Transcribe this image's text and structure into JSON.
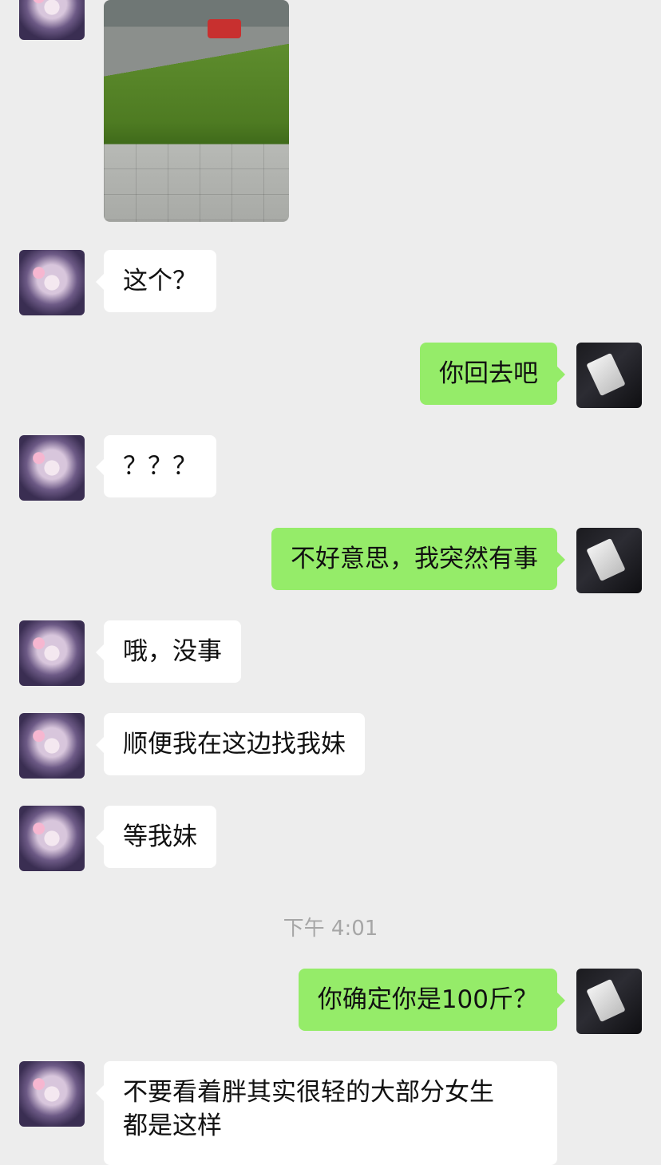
{
  "timestamp": "下午 4:01",
  "messages": [
    {
      "side": "left",
      "text": "这个？"
    },
    {
      "side": "right",
      "text": "你回去吧"
    },
    {
      "side": "left",
      "text": "？？？"
    },
    {
      "side": "right",
      "text": "不好意思，我突然有事"
    },
    {
      "side": "left",
      "text": "哦，没事"
    },
    {
      "side": "left",
      "text": "顺便我在这边找我妹"
    },
    {
      "side": "left",
      "text": "等我妹"
    },
    {
      "side": "right",
      "text": "你确定你是100斤？"
    },
    {
      "side": "left",
      "line1": "不要看着胖其实很轻的大部分女生",
      "line2": "都是这样"
    }
  ]
}
